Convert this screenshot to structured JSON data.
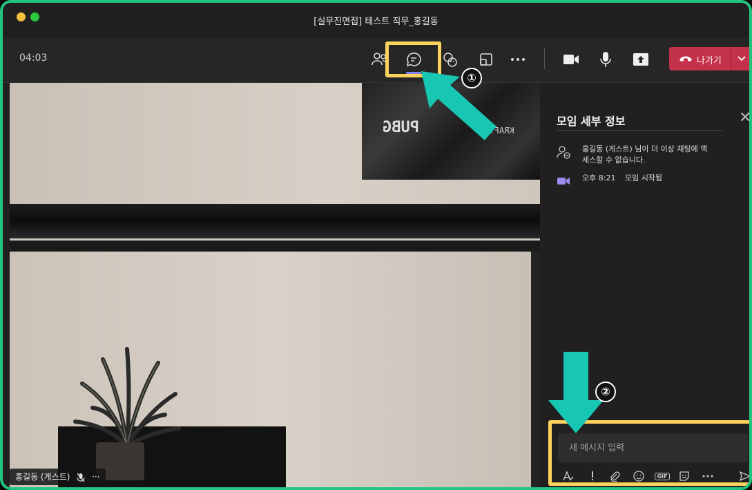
{
  "window": {
    "title": "[실무진면접] 테스트 직무_홍길동"
  },
  "toolbar": {
    "timer": "04:03",
    "leave_label": "나가기",
    "icons": [
      "people-icon",
      "chat-icon",
      "reactions-icon",
      "rooms-icon",
      "more-icon",
      "camera-icon",
      "mic-icon",
      "share-icon"
    ]
  },
  "annotations": {
    "step1": "①",
    "step2": "②",
    "highlight_color": "#fbd25c",
    "arrow_color": "#18c6b4"
  },
  "video": {
    "participant_label": "홍길동 (게스트)",
    "poster_text_left": "PUBG",
    "poster_text_right": "KRAFTON"
  },
  "panel": {
    "title": "모임 세부 정보",
    "events": [
      {
        "icon": "user-blocked-icon",
        "text": "홍길동 (게스트) 님이 더 이상 채팅에 액세스할 수 없습니다."
      },
      {
        "icon": "meeting-video-icon",
        "time": "오후 8:21",
        "text": "모임 시작됨"
      }
    ]
  },
  "compose": {
    "placeholder": "새 메시지 입력",
    "gif_label": "GIF"
  },
  "colors": {
    "accent": "#22c57e",
    "leave": "#c4314b",
    "active_tab": "#7f85f5"
  }
}
